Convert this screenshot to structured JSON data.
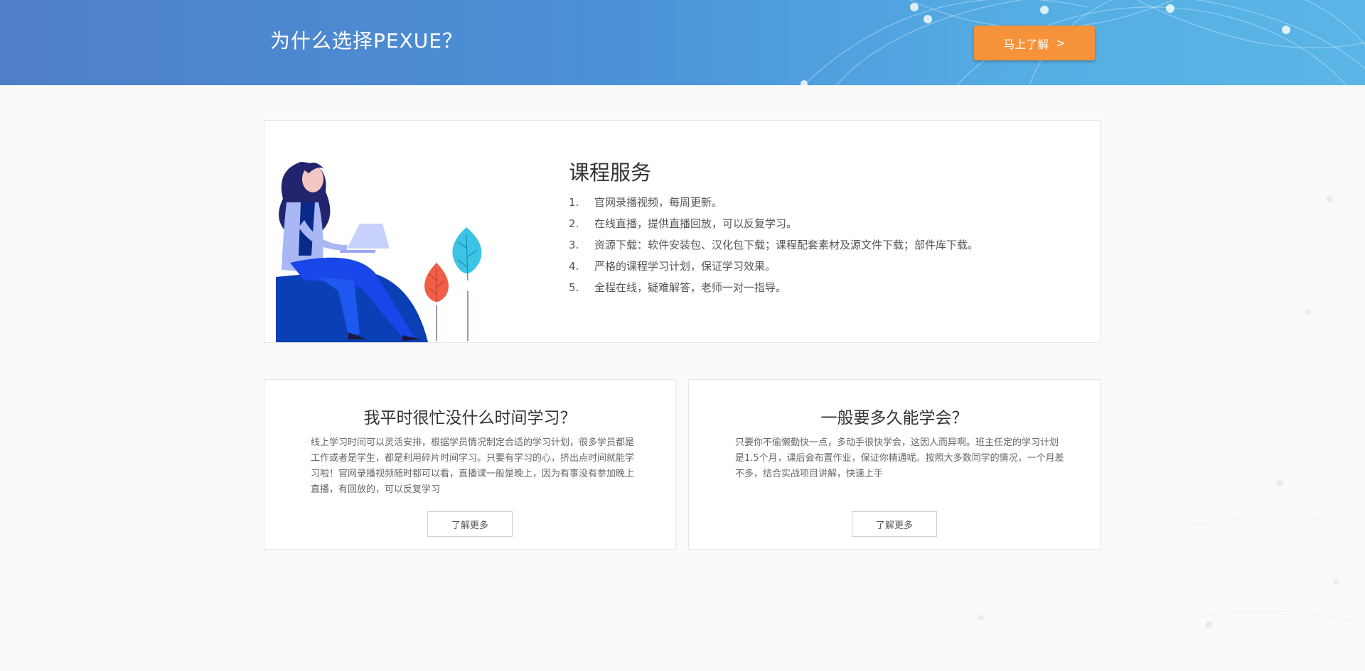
{
  "banner": {
    "title": "为什么选择PEXUE？",
    "cta_label": "马上了解",
    "cta_arrow": ">"
  },
  "service": {
    "title": "课程服务",
    "items": [
      {
        "num": "1.",
        "text": "官网录播视频，每周更新。"
      },
      {
        "num": "2.",
        "text": "在线直播，提供直播回放，可以反复学习。"
      },
      {
        "num": "3.",
        "text": "资源下载：软件安装包、汉化包下载；课程配套素材及源文件下载；部件库下载。"
      },
      {
        "num": "4.",
        "text": "严格的课程学习计划，保证学习效果。"
      },
      {
        "num": "5.",
        "text": "全程在线，疑难解答，老师一对一指导。"
      }
    ]
  },
  "faq": [
    {
      "title": "我平时很忙没什么时间学习？",
      "body": "线上学习时间可以灵活安排，根据学员情况制定合适的学习计划，很多学员都是工作或者是学生，都是利用碎片时间学习。只要有学习的心，挤出点时间就能学习啦！官网录播视频随时都可以看，直播课一般是晚上，因为有事没有参加晚上直播，有回放的，可以反复学习",
      "button": "了解更多"
    },
    {
      "title": "一般要多久能学会？",
      "body": "只要你不偷懒勤快一点，多动手很快学会，这因人而异啊。班主任定的学习计划是1.5个月，课后会布置作业，保证你精通呢。按照大多数同学的情况，一个月差不多，结合实战项目讲解，快速上手",
      "button": "了解更多"
    }
  ],
  "colors": {
    "cta": "#f5923a",
    "banner_start": "#4f7fc6",
    "banner_end": "#5ab6e6"
  }
}
